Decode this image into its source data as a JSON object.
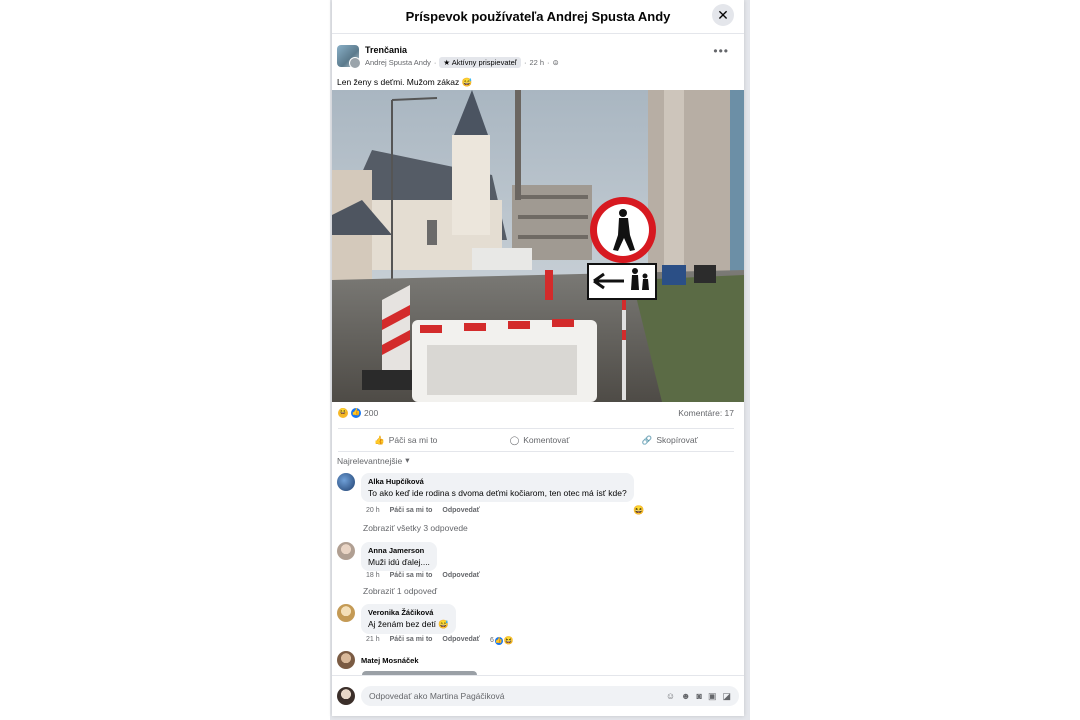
{
  "modal": {
    "title": "Príspevok používateľa Andrej Spusta Andy",
    "close_icon": "✕"
  },
  "post": {
    "group_name": "Trenčania",
    "author": "Andrej Spusta Andy",
    "badge": "Aktívny prispievateľ",
    "time": "22 h",
    "text": "Len ženy s deťmi. Mužom zákaz 😅",
    "reaction_count": "200",
    "comment_count": "Komentáre: 17"
  },
  "actions": {
    "like": "Páči sa mi to",
    "comment": "Komentovať",
    "copy": "Skopírovať"
  },
  "sort_label": "Najrelevantnejšie",
  "comments": [
    {
      "name": "Alka Hupčíková",
      "text": "To ako keď ide rodina s dvoma deťmi kočiarom, ten otec má ísť kde?",
      "time": "20 h",
      "like": "Páči sa mi to",
      "reply": "Odpovedať",
      "more": "Zobraziť všetky 3 odpovede"
    },
    {
      "name": "Anna Jamerson",
      "text": "Muži idú ďalej....",
      "time": "18 h",
      "like": "Páči sa mi to",
      "reply": "Odpovedať",
      "more": "Zobraziť 1 odpoveď"
    },
    {
      "name": "Veronika Žáčiková",
      "text": "Aj ženám bez detí 😅",
      "time": "21 h",
      "like": "Páči sa mi to",
      "reply": "Odpovedať",
      "reactions": "6"
    },
    {
      "name": "Matej Mosnáček"
    }
  ],
  "comment_box": {
    "placeholder": "Odpovedať ako Martina Pagáčiková"
  },
  "colors": {
    "accent": "#1877f2",
    "laugh": "#f7b928",
    "sign_red": "#d71920"
  }
}
